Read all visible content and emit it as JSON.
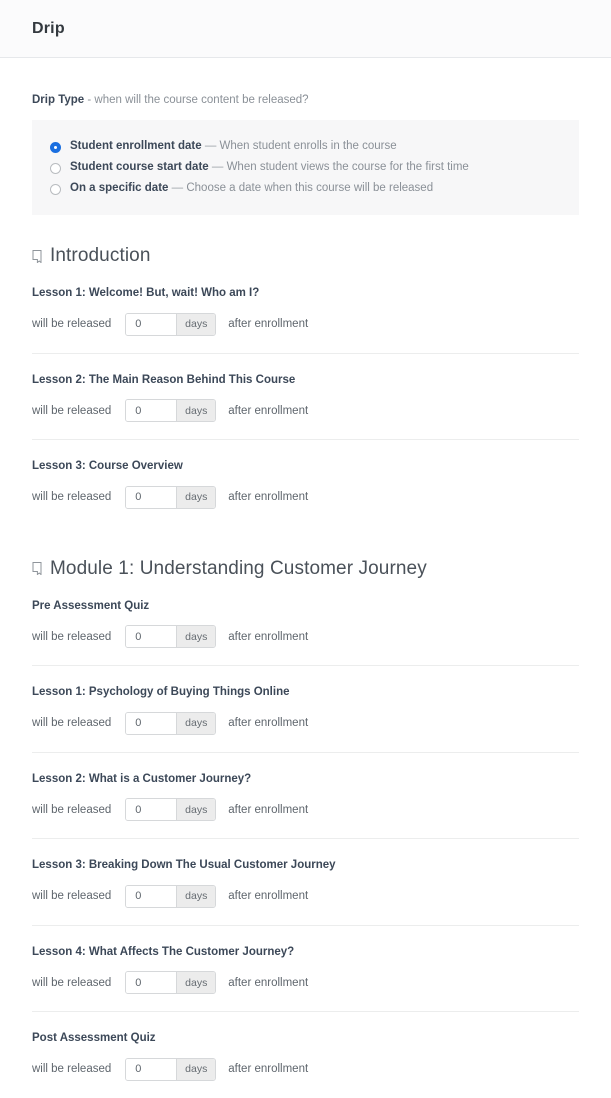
{
  "header": {
    "title": "Drip"
  },
  "drip_type": {
    "label_bold": "Drip Type",
    "label_rest": " - when will the course content be released?",
    "options": [
      {
        "title": "Student enrollment date",
        "dash": "—",
        "description": "When student enrolls in the course",
        "selected": true
      },
      {
        "title": "Student course start date",
        "dash": "—",
        "description": "When student views the course for the first time",
        "selected": false
      },
      {
        "title": "On a specific date",
        "dash": "—",
        "description": "Choose a date when this course will be released",
        "selected": false
      }
    ]
  },
  "row_labels": {
    "before": "will be released",
    "unit": "days",
    "after": "after enrollment",
    "value": "0",
    "placeholder": "0"
  },
  "icons": {
    "section": "book-icon"
  },
  "colors": {
    "accent": "#1b6fe0",
    "panel_bg": "#f7f7f8",
    "header_bg": "#fbfbfc",
    "text": "#3c4858",
    "muted": "#8a9097",
    "rule": "#eceded"
  },
  "sections": [
    {
      "name": "Introduction",
      "lessons": [
        {
          "title": "Lesson 1: Welcome! But, wait! Who am I?",
          "value": "0"
        },
        {
          "title": "Lesson 2: The Main Reason Behind This Course",
          "value": "0"
        },
        {
          "title": "Lesson 3: Course Overview",
          "value": "0"
        }
      ]
    },
    {
      "name": "Module 1: Understanding Customer Journey",
      "lessons": [
        {
          "title": "Pre Assessment Quiz",
          "value": "0"
        },
        {
          "title": "Lesson 1: Psychology of Buying Things Online",
          "value": "0"
        },
        {
          "title": "Lesson 2: What is a Customer Journey?",
          "value": "0"
        },
        {
          "title": "Lesson 3: Breaking Down The Usual Customer Journey",
          "value": "0"
        },
        {
          "title": "Lesson 4: What Affects The Customer Journey?",
          "value": "0"
        },
        {
          "title": "Post Assessment Quiz",
          "value": "0"
        }
      ]
    }
  ]
}
